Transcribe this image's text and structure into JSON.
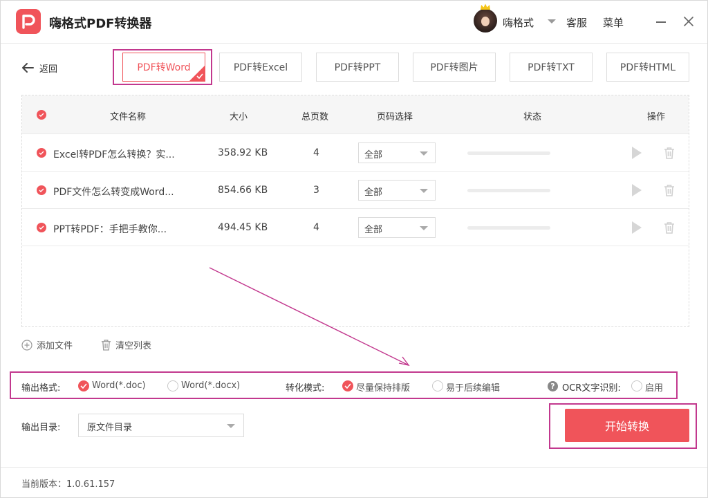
{
  "app": {
    "title": "嗨格式PDF转换器",
    "logo_icon": "logo-p-icon",
    "accent_color": "#f0545a",
    "highlight_color": "#c2388e"
  },
  "header": {
    "username": "嗨格式",
    "service_label": "客服",
    "menu_label": "菜单"
  },
  "nav": {
    "back_label": "返回"
  },
  "tabs": [
    {
      "label": "PDF转Word",
      "active": true
    },
    {
      "label": "PDF转Excel",
      "active": false
    },
    {
      "label": "PDF转PPT",
      "active": false
    },
    {
      "label": "PDF转图片",
      "active": false
    },
    {
      "label": "PDF转TXT",
      "active": false
    },
    {
      "label": "PDF转HTML",
      "active": false
    }
  ],
  "table": {
    "headers": {
      "name": "文件名称",
      "size": "大小",
      "pages": "总页数",
      "page_select": "页码选择",
      "status": "状态",
      "actions": "操作"
    },
    "rows": [
      {
        "name": "Excel转PDF怎么转换？实...",
        "size": "358.92 KB",
        "pages": "4",
        "page_select": "全部",
        "progress": 0
      },
      {
        "name": "PDF文件怎么转变成Word...",
        "size": "854.66 KB",
        "pages": "3",
        "page_select": "全部",
        "progress": 0
      },
      {
        "name": "PPT转PDF：手把手教你...",
        "size": "494.45 KB",
        "pages": "4",
        "page_select": "全部",
        "progress": 0
      }
    ]
  },
  "actions": {
    "add_file": "添加文件",
    "clear_list": "清空列表"
  },
  "options": {
    "output_format_label": "输出格式:",
    "format_doc": "Word(*.doc)",
    "format_docx": "Word(*.docx)",
    "format_selected": "doc",
    "mode_label": "转化模式:",
    "mode_keep_layout": "尽量保持排版",
    "mode_easy_edit": "易于后续编辑",
    "mode_selected": "keep_layout",
    "ocr_label": "OCR文字识别:",
    "ocr_enable": "启用",
    "ocr_enabled": false
  },
  "output": {
    "dir_label": "输出目录:",
    "dir_value": "原文件目录"
  },
  "start_button": "开始转换",
  "footer": {
    "version": "当前版本：1.0.61.157"
  }
}
